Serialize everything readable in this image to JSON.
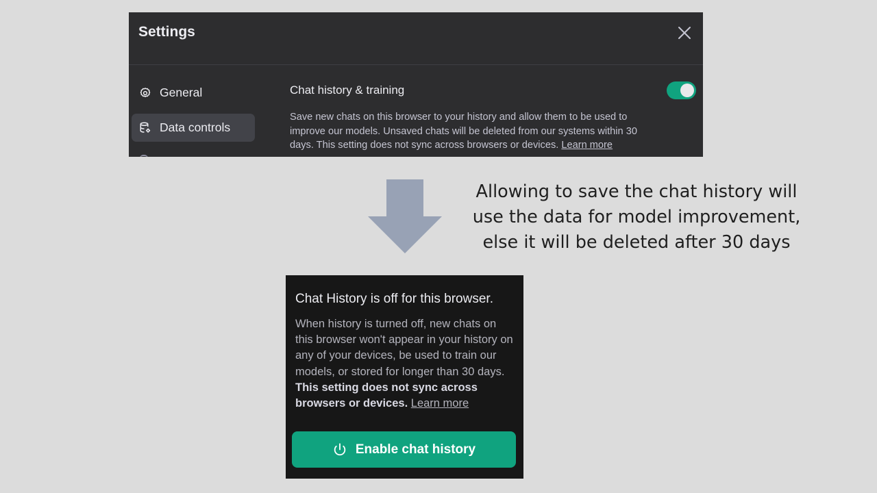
{
  "settings": {
    "title": "Settings",
    "sidebar": {
      "items": [
        {
          "label": "General",
          "icon": "gear-icon",
          "active": false
        },
        {
          "label": "Data controls",
          "icon": "database-icon",
          "active": true
        }
      ]
    },
    "chat_history": {
      "title": "Chat history & training",
      "enabled": true,
      "description": "Save new chats on this browser to your history and allow them to be used to improve our models. Unsaved chats will be deleted from our systems within 30 days. This setting does not sync across browsers or devices.",
      "link": "Learn more"
    }
  },
  "annotation": {
    "lines": [
      "Allowing to save the chat history will",
      "use the data for model improvement,",
      "else it will be deleted after 30 days"
    ]
  },
  "history_off": {
    "title": "Chat History is off for this browser.",
    "description": "When history is turned off, new chats on this browser won't appear in your history on any of your devices, be used to train our models, or stored for longer than 30 days.",
    "bold": "This setting does not sync across browsers or devices.",
    "link": "Learn more",
    "button_label": "Enable chat history"
  },
  "colors": {
    "accent": "#10a37f",
    "panel": "#2d2d2f",
    "panel_dark": "#171717",
    "arrow": "#98a2b5"
  }
}
